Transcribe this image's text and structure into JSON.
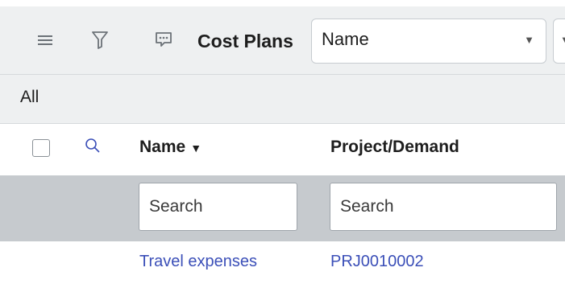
{
  "header": {
    "title": "Cost Plans",
    "icons": {
      "menu": "hamburger-menu-icon",
      "filter": "funnel-filter-icon",
      "chat": "chat-bubble-icon"
    },
    "field_select": {
      "value": "Name"
    }
  },
  "breadcrumb": {
    "label": "All"
  },
  "columns": [
    {
      "label": "Name",
      "sorted": "descending"
    },
    {
      "label": "Project/Demand"
    }
  ],
  "sort_indicator": "▼",
  "search": {
    "name_placeholder": "Search",
    "project_placeholder": "Search"
  },
  "rows": [
    {
      "name": "Travel expenses",
      "project": "PRJ0010002"
    }
  ],
  "colors": {
    "link": "#3b4fb8",
    "header_bg": "#eef0f1",
    "search_row_bg": "#c6cace"
  }
}
